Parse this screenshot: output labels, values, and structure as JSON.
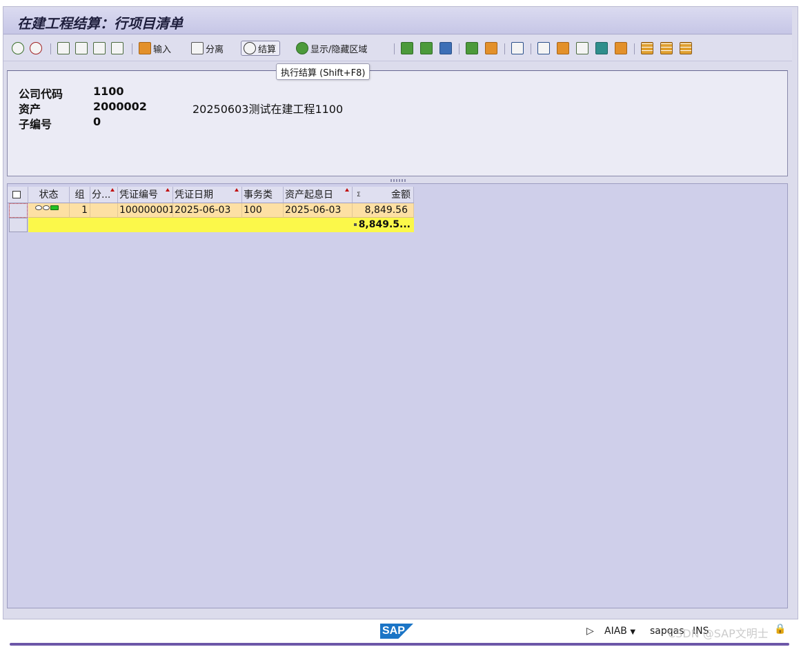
{
  "window": {
    "title": "在建工程结算：行项目清单"
  },
  "toolbar": {
    "input_label": "输入",
    "split_label": "分离",
    "settle_label": "结算",
    "toggle_area_label": "显示/隐藏区域"
  },
  "tooltip": {
    "text": "执行结算   (Shift+F8)"
  },
  "header": {
    "company_code_label": "公司代码",
    "company_code_value": "1100",
    "asset_label": "资产",
    "asset_value": "2000002",
    "asset_desc": "20250603测试在建工程1100",
    "subnumber_label": "子编号",
    "subnumber_value": "0"
  },
  "table": {
    "columns": [
      "状态",
      "组",
      "分...",
      "凭证编号",
      "凭证日期",
      "事务类",
      "资产起息日",
      "金额"
    ],
    "rows": [
      {
        "status": "green",
        "group": "1",
        "split": "",
        "doc_no": "100000001",
        "doc_date": "2025-06-03",
        "trans_type": "100",
        "value_date": "2025-06-03",
        "amount": "8,849.56"
      }
    ],
    "total": "8,849.5..."
  },
  "statusbar": {
    "client": "AIAB",
    "system": "sapqas",
    "mode": "INS",
    "watermark": "CSDN @SAP文明士"
  },
  "colors": {
    "title_bg": "#c6c6e6",
    "row_bg": "#fde0a4",
    "total_bg": "#fbf84a",
    "grid_bg": "#cfcfea"
  }
}
